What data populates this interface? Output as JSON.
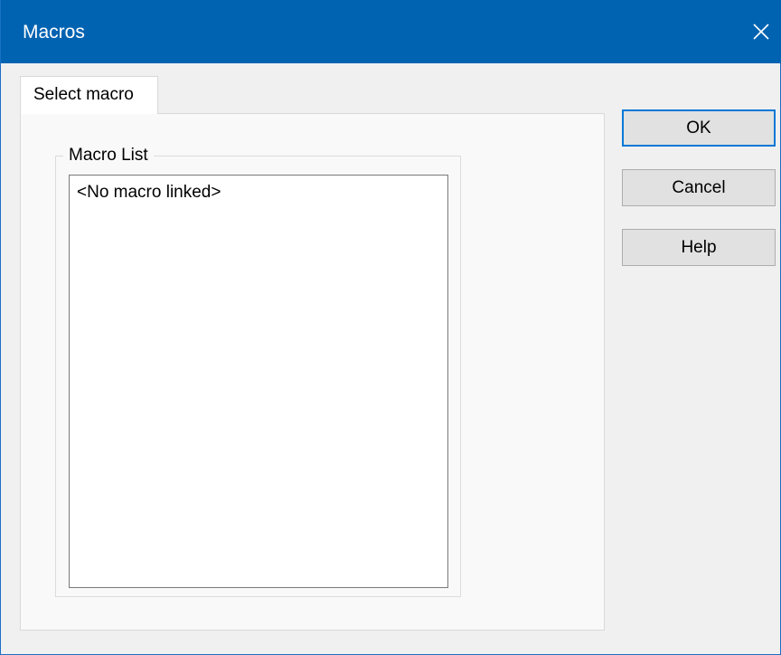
{
  "window": {
    "title": "Macros"
  },
  "tabs": [
    {
      "label": "Select macro"
    }
  ],
  "macro_list": {
    "label": "Macro List",
    "items": [
      "<No macro linked>"
    ]
  },
  "buttons": {
    "ok_label": "OK",
    "cancel_label": "Cancel",
    "help_label": "Help"
  },
  "colors": {
    "titlebar": "#0063b1",
    "default_button_border": "#0078d7",
    "dialog_background": "#f0f0f0"
  }
}
